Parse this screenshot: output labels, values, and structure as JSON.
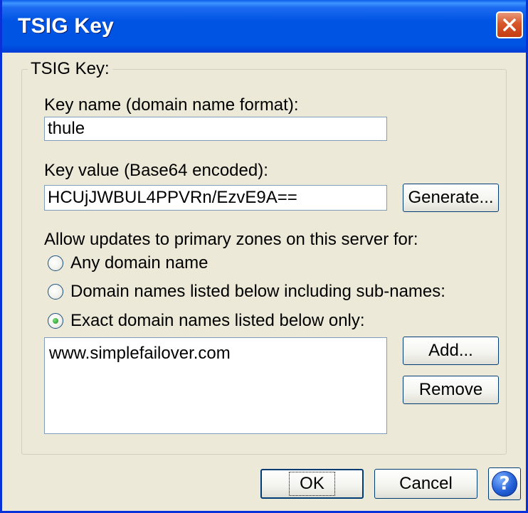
{
  "window": {
    "title": "TSIG Key",
    "close_icon": "close-x-icon"
  },
  "group": {
    "label": "TSIG Key:"
  },
  "key_name": {
    "label": "Key name (domain name format):",
    "value": "thule"
  },
  "key_value": {
    "label": "Key value (Base64 encoded):",
    "value": "HCUjJWBUL4PPVRn/EzvE9A==",
    "generate_label": "Generate..."
  },
  "updates": {
    "label": "Allow updates to primary zones on this server for:",
    "options": [
      {
        "label": "Any domain name",
        "selected": false
      },
      {
        "label": "Domain names listed below including sub-names:",
        "selected": false
      },
      {
        "label": "Exact domain names listed below only:",
        "selected": true
      }
    ]
  },
  "domains": {
    "items": [
      "www.simplefailover.com"
    ],
    "add_label": "Add...",
    "remove_label": "Remove"
  },
  "footer": {
    "ok_label": "OK",
    "cancel_label": "Cancel",
    "help_symbol": "?"
  },
  "colors": {
    "titlebar": "#0054e3",
    "dialog_bg": "#ece9d8",
    "close_button": "#d8562b",
    "radio_selected": "#21a121"
  }
}
